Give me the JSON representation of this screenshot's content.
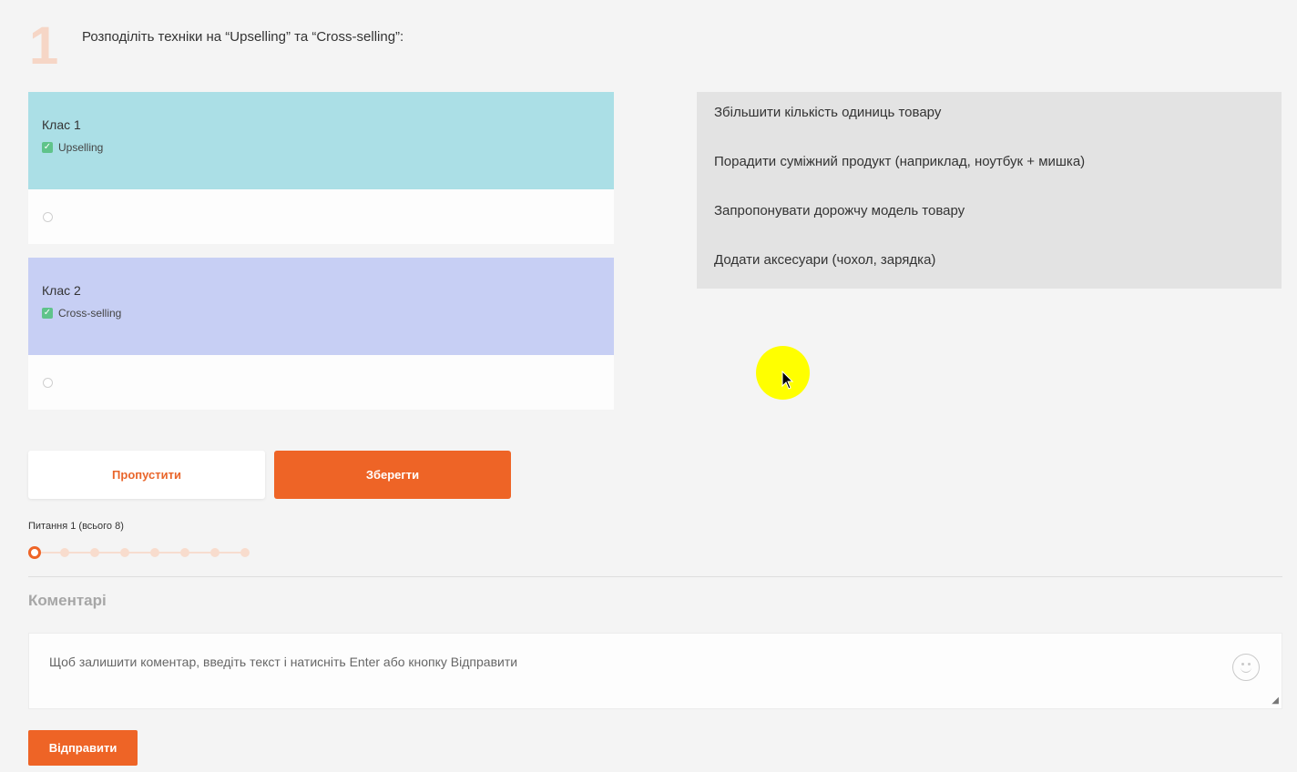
{
  "question": {
    "number": "1",
    "text": "Розподіліть техніки на “Upselling” та “Cross-selling”:"
  },
  "classes": [
    {
      "title": "Клас 1",
      "tag": "Upselling",
      "color": "#abdfe6"
    },
    {
      "title": "Клас 2",
      "tag": "Cross-selling",
      "color": "#c7cff4"
    }
  ],
  "options": [
    "Збільшити кількість одиниць товару",
    "Порадити суміжний продукт (наприклад, ноутбук + мишка)",
    "Запропонувати дорожчу модель товару",
    "Додати аксесуари (чохол, зарядка)"
  ],
  "buttons": {
    "skip": "Пропустити",
    "save": "Зберегти"
  },
  "progress": {
    "label": "Питання 1 (всього 8)",
    "current": 1,
    "total": 8
  },
  "comments": {
    "title": "Коментарі",
    "placeholder": "Щоб залишити коментар, введіть текст і натисніть Enter або кнопку Відправити",
    "send_label": "Відправити"
  },
  "colors": {
    "accent": "#ee6426",
    "cursor_highlight": "#ffff00"
  }
}
